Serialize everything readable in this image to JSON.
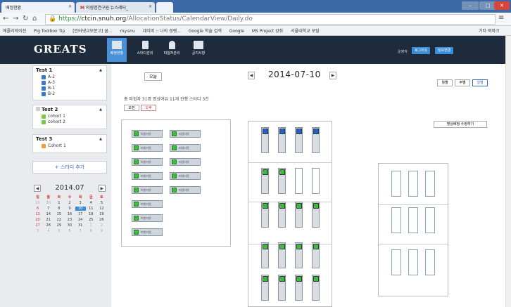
{
  "browser": {
    "tabs": [
      {
        "title": "배정현황",
        "active": true
      },
      {
        "title": "의생명연구원 뉴스레터_",
        "active": false
      }
    ],
    "url": {
      "scheme": "https://",
      "host": "ctcin.snuh.org",
      "path": "/AllocationStatus/CalendarView/Daily.do"
    },
    "bookmarks": [
      "애플리케이션",
      "Pig Toolbox Tip",
      "[인터넷교보문고] 꿈...",
      "my.snu",
      "네이버 :: 나의 경쟁...",
      "Google 학술 검색",
      "Google",
      "MS Project 강좌",
      "서울대학교 포털"
    ],
    "other_bookmarks": "기타 북마크"
  },
  "header": {
    "logo": "GREATS",
    "nav": [
      {
        "label": "배정현황",
        "icon": "layout-icon",
        "active": true
      },
      {
        "label": "스터디관리",
        "icon": "document-icon",
        "active": false
      },
      {
        "label": "피험자관리",
        "icon": "person-icon",
        "active": false
      },
      {
        "label": "공지사항",
        "icon": "monitor-icon",
        "active": false
      }
    ],
    "user": "운영자",
    "logout": "로그아웃",
    "profile": "정보변경"
  },
  "sidebar": {
    "groups": [
      {
        "title": "Test 1",
        "items": [
          "A-2",
          "A-3",
          "B-1",
          "B-2"
        ],
        "color": "#3b78c9"
      },
      {
        "title": "Test 2",
        "items": [
          "cohort 1",
          "cohort 2"
        ],
        "color": "#7ac943"
      },
      {
        "title": "Test 3",
        "items": [
          "Cohort 1"
        ],
        "color": "#f0a030"
      }
    ],
    "add_study": "+ 스터디 추가",
    "calendar": {
      "title": "2014.07",
      "weekdays": [
        "일",
        "월",
        "화",
        "수",
        "목",
        "금",
        "토"
      ],
      "weeks": [
        [
          "29",
          "30",
          "1",
          "2",
          "3",
          "4",
          "5"
        ],
        [
          "6",
          "7",
          "8",
          "9",
          "10",
          "11",
          "12"
        ],
        [
          "13",
          "14",
          "15",
          "16",
          "17",
          "18",
          "19"
        ],
        [
          "20",
          "21",
          "22",
          "23",
          "24",
          "25",
          "26"
        ],
        [
          "27",
          "28",
          "29",
          "30",
          "31",
          "1",
          "2"
        ],
        [
          "3",
          "4",
          "5",
          "6",
          "7",
          "8",
          "9"
        ]
      ],
      "today": "10"
    }
  },
  "main": {
    "today_button": "오늘",
    "date": "2014-07-10",
    "views": [
      "월별",
      "주별",
      "일별"
    ],
    "active_view": "일별",
    "summary": "총 피험자  31명     명상여유  11개     진행 스터디  3건",
    "sessions": [
      "오전",
      "오후"
    ],
    "edit_layout": "명상배정 수정하기",
    "room1_seats": [
      "피험자명",
      "피험자명",
      "피험자명",
      "피험자명",
      "피험자명",
      "피험자명",
      "피험자명",
      "피험자명",
      "피험자명",
      "피험자명",
      "피험자명",
      "피험자명",
      "피험자명"
    ]
  },
  "colors": {
    "accent": "#3b8ed8",
    "header_bg": "#1d2b3d",
    "green": "#3ebd3a",
    "blue": "#2463c9"
  }
}
